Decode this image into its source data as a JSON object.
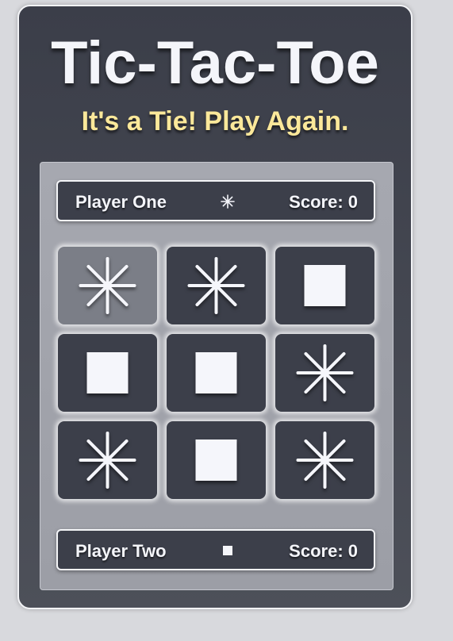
{
  "game": {
    "title": "Tic-Tac-Toe",
    "status": "It's a Tie! Play Again."
  },
  "players": [
    {
      "name": "Player One",
      "mark": "star-icon",
      "score": "Score: 0"
    },
    {
      "name": "Player Two",
      "mark": "square-icon",
      "score": "Score: 0"
    }
  ],
  "board": {
    "cells": [
      "star",
      "star",
      "square",
      "square",
      "square",
      "star",
      "star",
      "square",
      "star"
    ],
    "highlighted_cell": 0
  },
  "colors": {
    "background": "#d8d9dd",
    "panel": "#3b3e49",
    "cell": "#3c3f4a",
    "cell_highlight": "#7b7e87",
    "status_text": "#fbe89a",
    "mark": "#f5f6fb"
  }
}
